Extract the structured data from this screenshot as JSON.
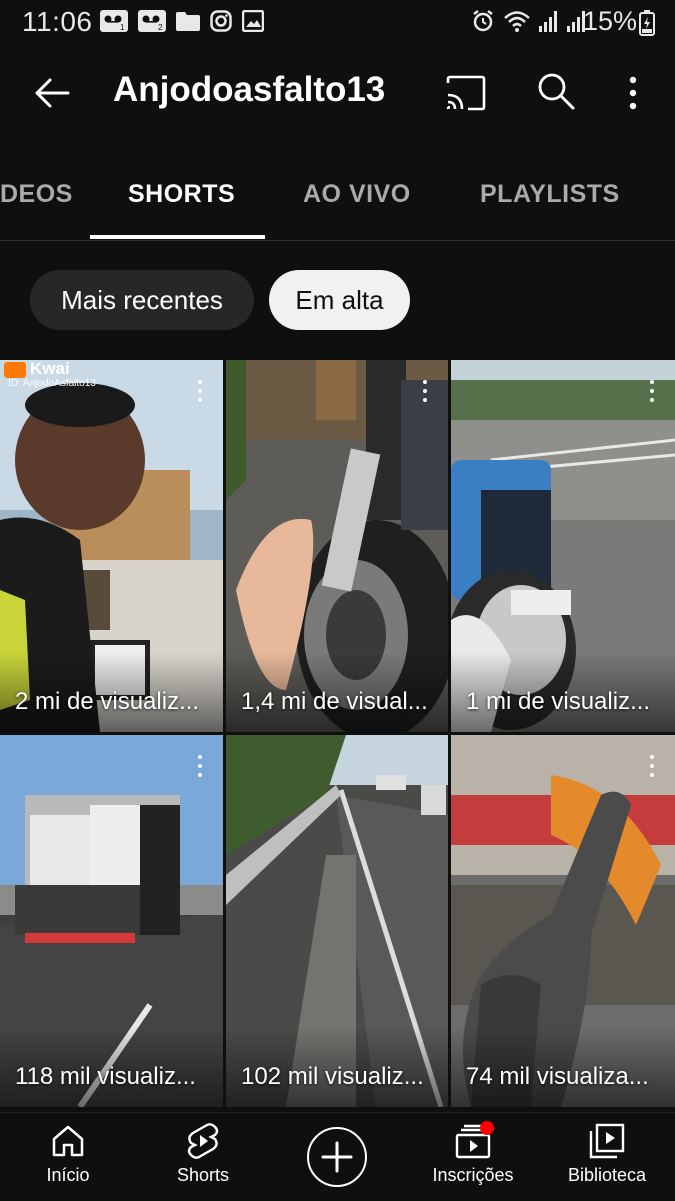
{
  "status_bar": {
    "time": "11:06",
    "battery": "15%",
    "left_icons": [
      "voicemail-1-icon",
      "voicemail-2-icon",
      "folder-icon",
      "instagram-icon",
      "gallery-icon"
    ],
    "right_icons": [
      "alarm-icon",
      "wifi-icon",
      "signal-1-icon",
      "signal-2-icon",
      "battery-icon"
    ]
  },
  "header": {
    "title": "Anjodoasfalto13",
    "icons": [
      "back-arrow-icon",
      "cast-icon",
      "search-icon",
      "more-vert-icon"
    ]
  },
  "tabs": [
    {
      "label": "DEOS",
      "active": false
    },
    {
      "label": "SHORTS",
      "active": true
    },
    {
      "label": "AO VIVO",
      "active": false
    },
    {
      "label": "PLAYLISTS",
      "active": false
    }
  ],
  "chips": [
    {
      "label": "Mais recentes",
      "active": false
    },
    {
      "label": "Em alta",
      "active": true
    }
  ],
  "shorts": [
    {
      "views": "2 mi de visualiz...",
      "overlay_brand": "Kwai",
      "overlay_id": "ID: AnjodoAsfalto13"
    },
    {
      "views": "1,4 mi de visual..."
    },
    {
      "views": "1 mi de visualiz..."
    },
    {
      "views": "118 mil visualiz..."
    },
    {
      "views": "102 mil visualiz..."
    },
    {
      "views": "74 mil visualiza..."
    }
  ],
  "bottom_nav": [
    {
      "label": "Início",
      "icon": "home-icon"
    },
    {
      "label": "Shorts",
      "icon": "shorts-icon"
    },
    {
      "label": "",
      "icon": "create-plus-icon"
    },
    {
      "label": "Inscrições",
      "icon": "subscriptions-icon",
      "badge": true
    },
    {
      "label": "Biblioteca",
      "icon": "library-icon"
    }
  ],
  "colors": {
    "background": "#0f0f0f",
    "chip_inactive": "#272727",
    "chip_active": "#f1f1f1",
    "notification": "#ff0000"
  }
}
